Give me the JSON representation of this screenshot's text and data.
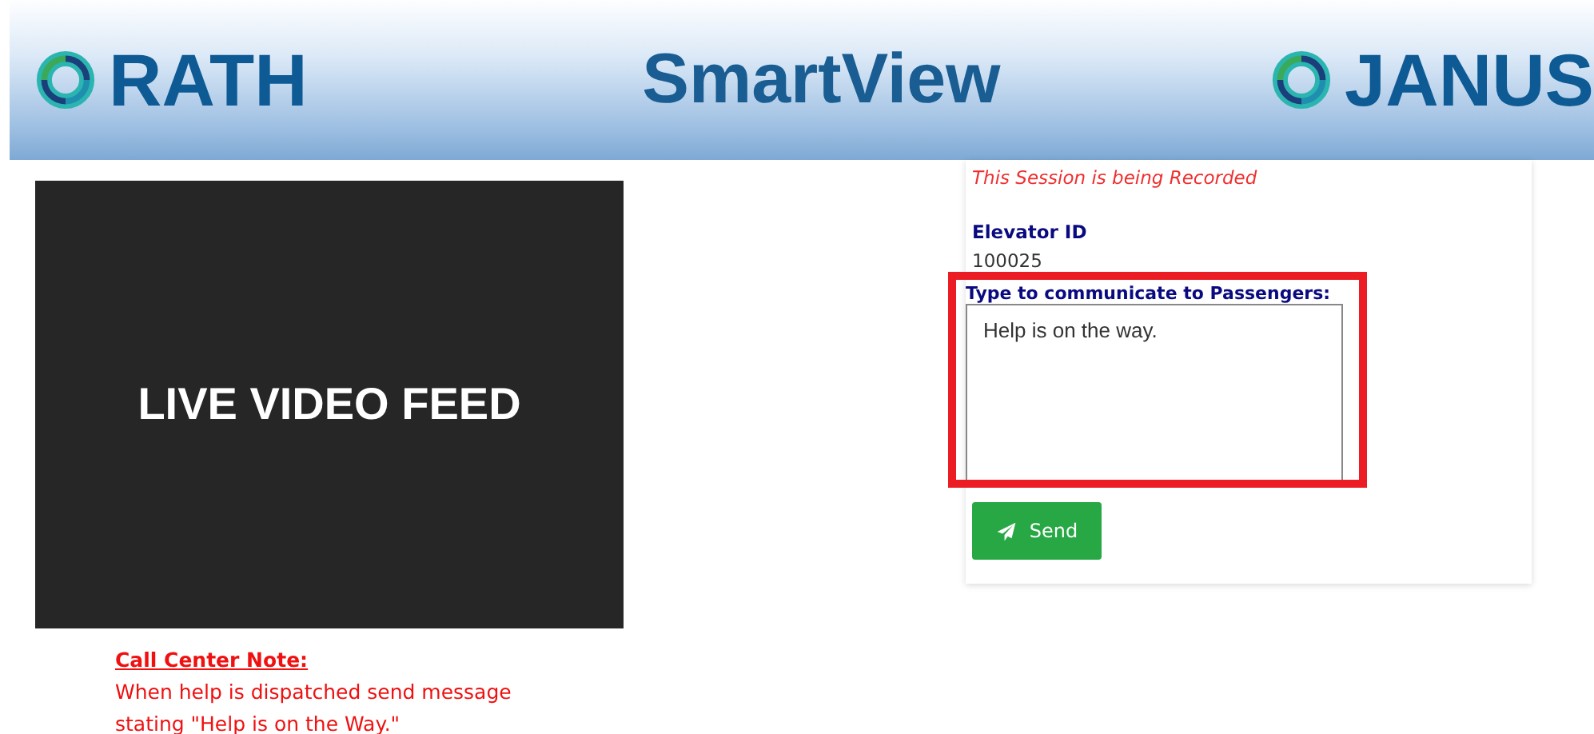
{
  "header": {
    "left_logo": "RATH",
    "title": "SmartView",
    "right_logo": "JANUS"
  },
  "video": {
    "label": "LIVE VIDEO FEED"
  },
  "note": {
    "heading": "Call Center Note:",
    "text": "When help is dispatched send message stating \"Help is on the Way.\""
  },
  "panel": {
    "recording_notice": "This Session is being Recorded",
    "elevator_id_label": "Elevator ID",
    "elevator_id": "100025",
    "message_label": "Type to communicate to Passengers:",
    "message": "Help is on the way.",
    "highlighted": true,
    "send_button": "Send"
  }
}
